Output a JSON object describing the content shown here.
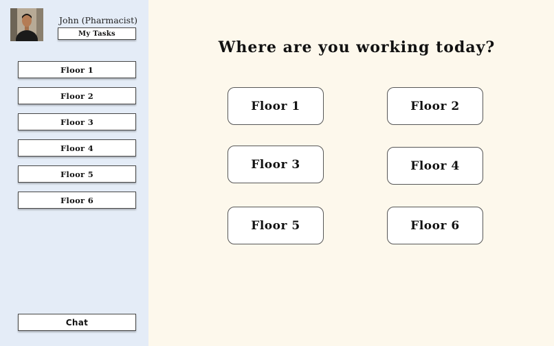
{
  "user": {
    "name": "John (Pharmacist)",
    "tasks_label": "My Tasks"
  },
  "sidebar": {
    "floors": [
      "Floor 1",
      "Floor 2",
      "Floor 3",
      "Floor 4",
      "Floor 5",
      "Floor 6"
    ],
    "chat_label": "Chat"
  },
  "main": {
    "title": "Where are you working today?",
    "floors": [
      "Floor 1",
      "Floor 2",
      "Floor 3",
      "Floor 4",
      "Floor 5",
      "Floor 6"
    ]
  },
  "colors": {
    "sidebar_bg": "#e4ecf7",
    "main_bg": "#fdf8ec"
  }
}
